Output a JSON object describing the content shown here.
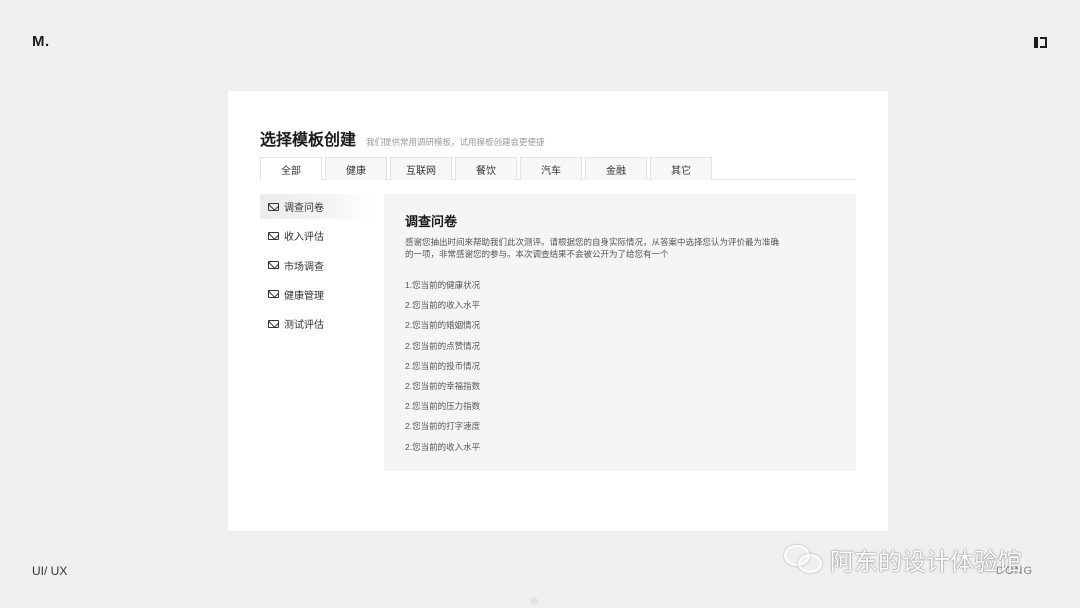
{
  "brand": "M.",
  "footer": {
    "left": "UI/ UX",
    "right": "DONG"
  },
  "watermark": "阿东的设计体验馆",
  "page": {
    "title": "选择模板创建",
    "subtitle": "我们提供常用调研模板，试用模板创建会更便捷"
  },
  "tabs": [
    {
      "label": "全部",
      "active": true
    },
    {
      "label": "健康"
    },
    {
      "label": "互联网"
    },
    {
      "label": "餐饮"
    },
    {
      "label": "汽车"
    },
    {
      "label": "金融"
    },
    {
      "label": "其它"
    }
  ],
  "sidebar": {
    "items": [
      {
        "label": "调查问卷",
        "active": true
      },
      {
        "label": "收入评估"
      },
      {
        "label": "市场调查"
      },
      {
        "label": "健康管理"
      },
      {
        "label": "测试评估"
      }
    ]
  },
  "content": {
    "title": "调查问卷",
    "description": "感谢您抽出时间来帮助我们此次测评。请根据您的自身实际情况，从答案中选择您认为评价最为准确的一项，非常感谢您的参与。本次调查结果不会被公开为了给您有一个",
    "questions": [
      "1.您当前的健康状况",
      "2.您当前的收入水平",
      "2.您当前的婚姻情况",
      "2.您当前的点赞情况",
      "2.您当前的投币情况",
      "2.您当前的幸福指数",
      "2.您当前的压力指数",
      "2.您当前的打字速度",
      "2.您当前的收入水平"
    ]
  }
}
